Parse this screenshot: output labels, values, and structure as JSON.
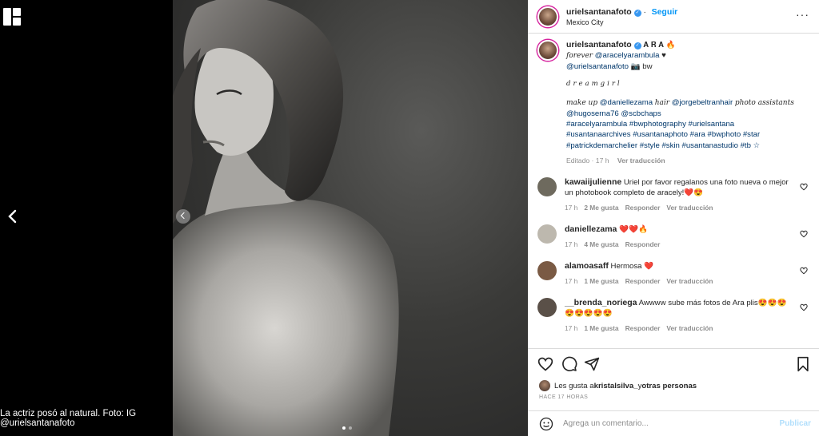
{
  "caption": "La actriz posó al natural. Foto: IG @urielsantanafoto",
  "post": {
    "username": "urielsantanafoto",
    "follow": "Seguir",
    "location": "Mexico City",
    "more": "···"
  },
  "caption_block": {
    "username": "urielsantanafoto",
    "title": "𝐀 𝐑 𝐀 🔥",
    "l2a": "forever",
    "l2b": "@aracelyarambula",
    "l2c": "♥",
    "l3a": "@urielsantanafoto",
    "l3b": "📷 bw",
    "l4": "dreamgirl",
    "l5a": "make up",
    "l5b": "@daniellezama",
    "l5c": "hair",
    "l5d": "@jorgebeltranhair",
    "l5e": "photo assistants",
    "l6": "@hugoserna76 @scbchaps",
    "l7": "#aracelyarambula #bwphotography #urielsantana",
    "l8": "#usantanaarchives #usantanaphoto #ara #bwphoto #star",
    "l9": "#patrickdemarchelier #style #skin #usantanastudio #tb ☆",
    "edited": "Editado · 17 h",
    "translate": "Ver traducción"
  },
  "comments": [
    {
      "user": "kawaiijulienne",
      "text": "Uriel por favor regalanos una foto nueva o mejor un photobook completo de aracely!❤️😍",
      "time": "17 h",
      "likes": "2 Me gusta",
      "reply": "Responder",
      "translate": "Ver traducción",
      "avatar_color": "#6e6a5e"
    },
    {
      "user": "daniellezama",
      "text": "❤️❤️🔥",
      "time": "17 h",
      "likes": "4 Me gusta",
      "reply": "Responder",
      "translate": "",
      "avatar_color": "#bdb8ae"
    },
    {
      "user": "alamoasaff",
      "text": "Hermosa ❤️",
      "time": "17 h",
      "likes": "1 Me gusta",
      "reply": "Responder",
      "translate": "Ver traducción",
      "avatar_color": "#7a5a44"
    },
    {
      "user": "__brenda_noriega",
      "text": "Awwww sube más fotos de Ara plis😍😍😍😍😍😍😍😍",
      "time": "17 h",
      "likes": "1 Me gusta",
      "reply": "Responder",
      "translate": "Ver traducción",
      "avatar_color": "#5a5048"
    }
  ],
  "likes_text": {
    "prefix": "Les gusta a ",
    "user": "kristalsilva_",
    "suffix": " y ",
    "others": "otras personas"
  },
  "ago": "HACE 17 HORAS",
  "add_comment": {
    "placeholder": "Agrega un comentario...",
    "publish": "Publicar"
  },
  "colors": {
    "accent": "#0095f6",
    "link": "#00376b",
    "muted": "#8e8e8e",
    "like_red": "#ed4956"
  }
}
